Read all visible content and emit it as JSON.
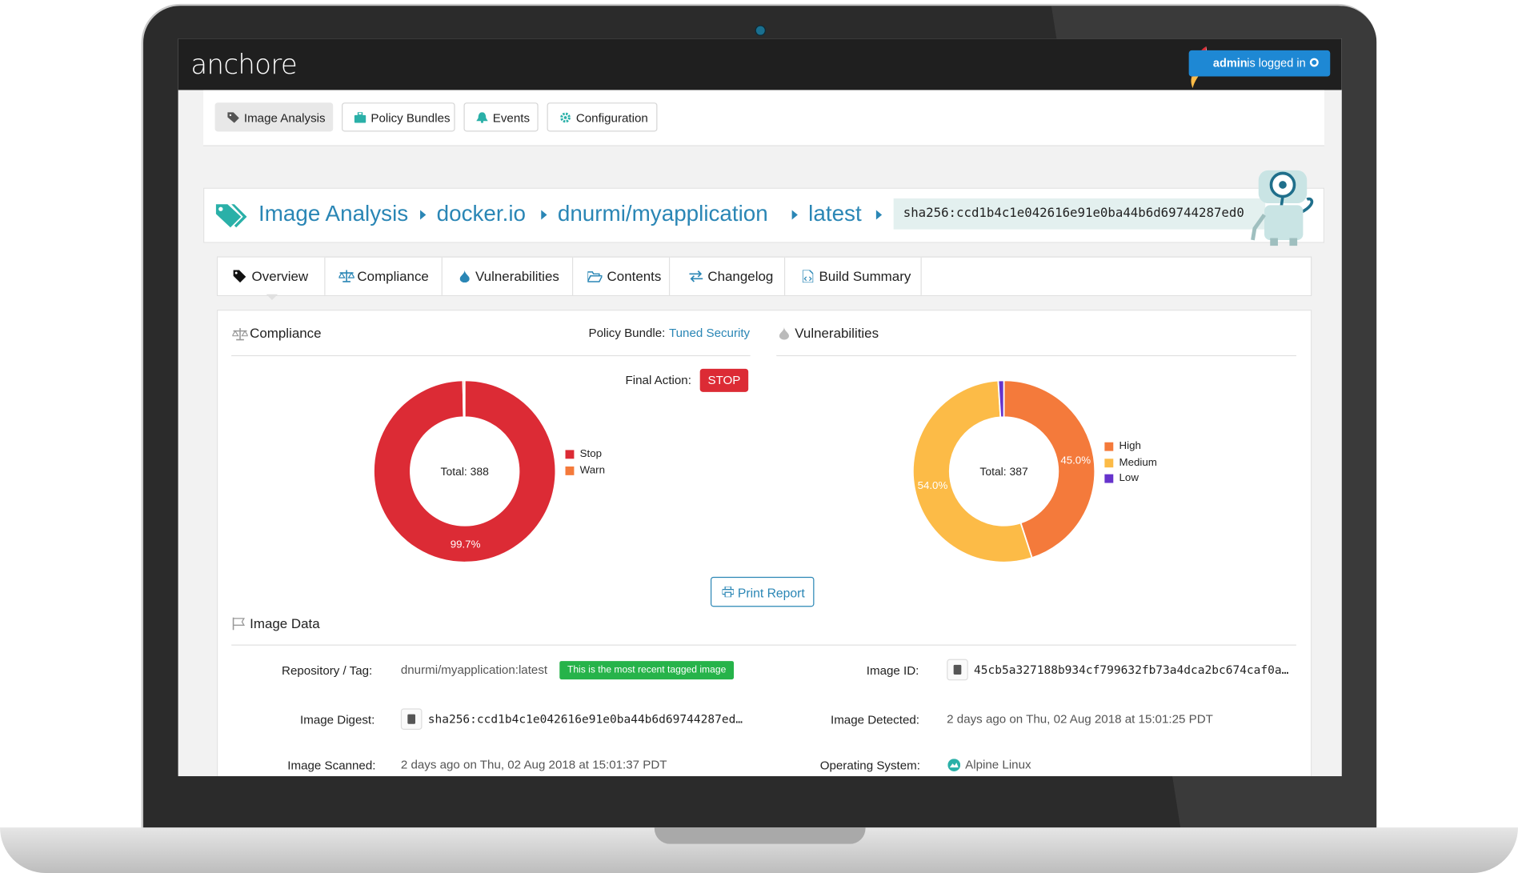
{
  "app": {
    "logo": "anchore",
    "user": {
      "name": "admin",
      "status": "is logged in"
    }
  },
  "nav": {
    "items": [
      {
        "label": "Image Analysis",
        "active": true,
        "icon": "tags-icon"
      },
      {
        "label": "Policy Bundles",
        "active": false,
        "icon": "briefcase-icon"
      },
      {
        "label": "Events",
        "active": false,
        "icon": "bell-icon"
      },
      {
        "label": "Configuration",
        "active": false,
        "icon": "gear-icon"
      }
    ]
  },
  "breadcrumb": {
    "items": [
      "Image Analysis",
      "docker.io",
      "dnurmi/myapplication",
      "latest"
    ],
    "digest": "sha256:ccd1b4c1e042616e91e0ba44b6d69744287ed0"
  },
  "tabs": [
    {
      "label": "Overview",
      "active": true,
      "icon": "tag-icon"
    },
    {
      "label": "Compliance",
      "icon": "balance-scale-icon"
    },
    {
      "label": "Vulnerabilities",
      "icon": "drop-icon"
    },
    {
      "label": "Contents",
      "icon": "folder-open-icon"
    },
    {
      "label": "Changelog",
      "icon": "exchange-icon"
    },
    {
      "label": "Build Summary",
      "icon": "file-code-icon"
    }
  ],
  "compliance": {
    "title": "Compliance",
    "bundle_label": "Policy Bundle:",
    "bundle_name": "Tuned Security",
    "final_action_label": "Final Action:",
    "final_action": "STOP"
  },
  "vulnerabilities": {
    "title": "Vulnerabilities"
  },
  "print_button": "Print Report",
  "image_data": {
    "title": "Image Data",
    "repo_tag_label": "Repository / Tag:",
    "repo_tag": "dnurmi/myapplication:latest",
    "recent_badge": "This is the most recent tagged image",
    "image_id_label": "Image ID:",
    "image_id": "45cb5a327188b934cf799632fb73a4dca2bc674caf0a…",
    "digest_label": "Image Digest:",
    "digest": "sha256:ccd1b4c1e042616e91e0ba44b6d69744287ed…",
    "detected_label": "Image Detected:",
    "detected": "2 days ago on Thu, 02 Aug 2018 at 15:01:25 PDT",
    "scanned_label": "Image Scanned:",
    "scanned": "2 days ago on Thu, 02 Aug 2018 at 15:01:37 PDT",
    "os_label": "Operating System:",
    "os": "Alpine Linux"
  },
  "chart_data": [
    {
      "type": "pie",
      "donut": true,
      "center_label": "Total:  388",
      "categories": [
        "Stop",
        "Warn"
      ],
      "values": [
        99.7,
        0.3
      ],
      "colors": [
        "#dc2b35",
        "#f47a3b"
      ],
      "data_labels": [
        "99.7%",
        ""
      ],
      "legend_position": "right"
    },
    {
      "type": "pie",
      "donut": true,
      "center_label": "Total:  387",
      "categories": [
        "High",
        "Medium",
        "Low"
      ],
      "values": [
        45.0,
        54.0,
        1.0
      ],
      "colors": [
        "#f47a3b",
        "#fcbb47",
        "#6633cc"
      ],
      "data_labels": [
        "45.0%",
        "54.0%",
        ""
      ],
      "legend_position": "right"
    }
  ]
}
